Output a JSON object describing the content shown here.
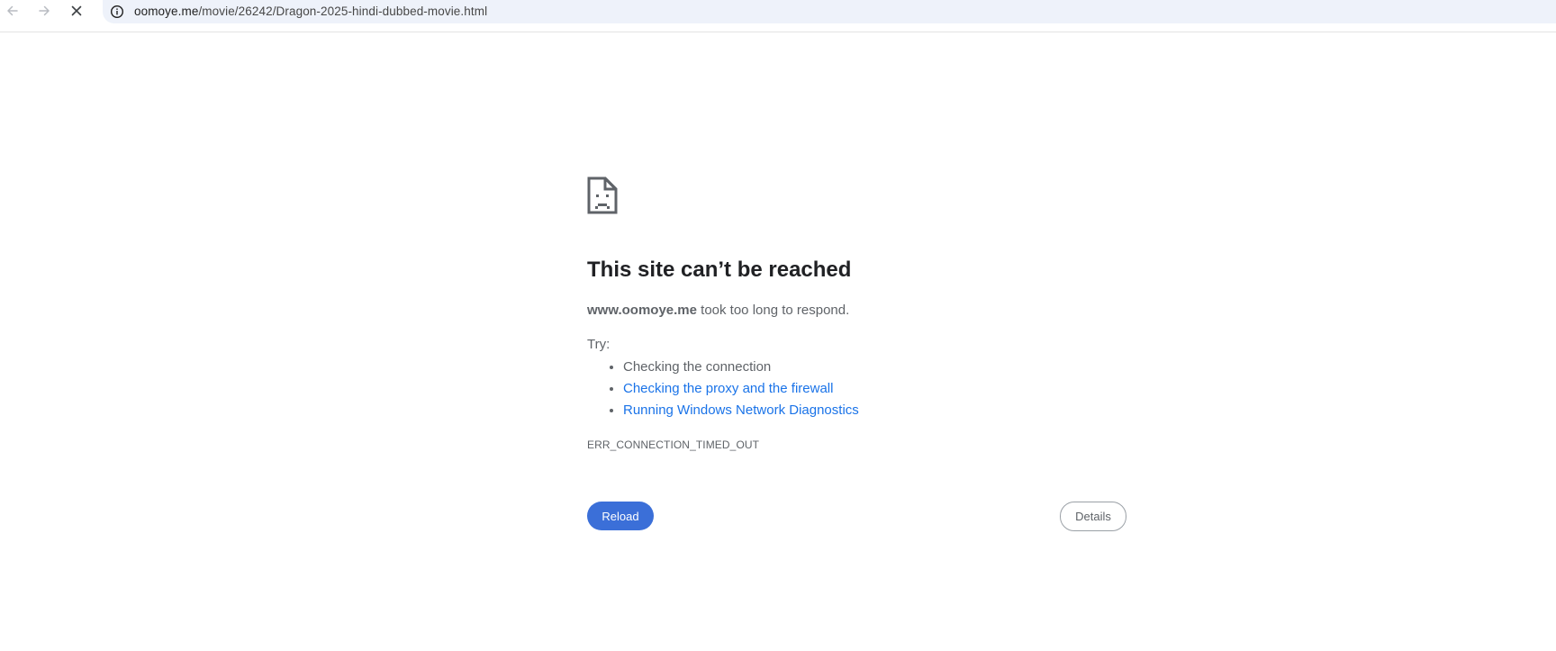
{
  "browser": {
    "url_host": "oomoye.me",
    "url_path": "/movie/26242/Dragon-2025-hindi-dubbed-movie.html",
    "back_icon": "arrow-left-icon",
    "forward_icon": "arrow-right-icon",
    "stop_icon": "close-icon",
    "site_info_icon": "info-icon"
  },
  "error_page": {
    "icon": "sad-document-icon",
    "title": "This site can’t be reached",
    "host": "www.oomoye.me",
    "summary_suffix": " took too long to respond.",
    "try_label": "Try:",
    "suggestions": [
      {
        "label": "Checking the connection",
        "is_link": false
      },
      {
        "label": "Checking the proxy and the firewall",
        "is_link": true
      },
      {
        "label": "Running Windows Network Diagnostics",
        "is_link": true
      }
    ],
    "error_code": "ERR_CONNECTION_TIMED_OUT",
    "reload_label": "Reload",
    "details_label": "Details"
  },
  "colors": {
    "accent": "#1a73e8",
    "reload_button": "#3b6fd8",
    "omnibox_bg": "#eef2fa",
    "body_text": "#5f6368",
    "title_text": "#202124"
  }
}
